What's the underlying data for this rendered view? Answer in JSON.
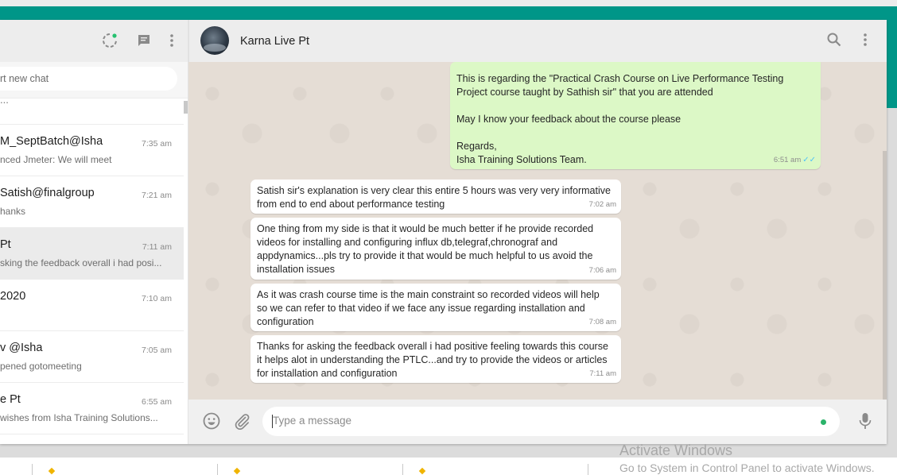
{
  "sidebar": {
    "search_placeholder": "rt new chat",
    "partial_top_text": "...",
    "chats": [
      {
        "name": "M_SeptBatch@Isha",
        "time": "7:35 am",
        "preview": "nced Jmeter: We will meet",
        "active": false
      },
      {
        "name": "Satish@finalgroup",
        "time": "7:21 am",
        "preview": "hanks",
        "active": false
      },
      {
        "name": "Pt",
        "time": "7:11 am",
        "preview": "sking the feedback overall i had posi...",
        "active": true
      },
      {
        "name": "2020",
        "time": "7:10 am",
        "preview": "",
        "active": false
      },
      {
        "name": "v @Isha",
        "time": "7:05 am",
        "preview": "pened gotomeeting",
        "active": false
      },
      {
        "name": "e Pt",
        "time": "6:55 am",
        "preview": "wishes from Isha Training Solutions...",
        "active": false
      }
    ]
  },
  "conversation": {
    "contact_name": "Karna Live Pt",
    "input_placeholder": "Type a message",
    "messages": [
      {
        "direction": "out",
        "lines": [
          "This is regarding the \"Practical Crash Course on Live Performance Testing",
          "Project  course taught by Sathish sir\" that you are attended",
          "",
          "May I know your feedback about the course please",
          "",
          "Regards,",
          "Isha Training Solutions Team."
        ],
        "time": "6:51 am",
        "ticks": "✓✓"
      },
      {
        "direction": "in",
        "lines": [
          "Satish sir's explanation is very clear this entire 5 hours was very very informative",
          "from end to end about performance testing"
        ],
        "time": "7:02 am"
      },
      {
        "direction": "in",
        "lines": [
          "One thing from my side is that it would be much better if he provide recorded",
          "videos for installing and configuring influx db,telegraf,chronograf and",
          "appdynamics...pls try to provide it that would be much helpful to us avoid the",
          "installation issues"
        ],
        "time": "7:06 am"
      },
      {
        "direction": "in",
        "lines": [
          "As it was crash course time is the main constraint so recorded videos will help",
          "so we can refer to that video if we face any issue regarding installation and",
          "configuration"
        ],
        "time": "7:08 am"
      },
      {
        "direction": "in",
        "lines": [
          "Thanks for asking the feedback overall i had positive feeling towards this course",
          "it helps alot in understanding the PTLC...and try to provide the videos or articles",
          "for installation and configuration"
        ],
        "time": "7:11 am"
      }
    ]
  },
  "os": {
    "activate_title": "Activate Windows",
    "activate_sub": "Go to System in Control Panel to activate Windows."
  },
  "colors": {
    "teal": "#009688",
    "outgoing_bubble": "#dcf8c6",
    "incoming_bubble": "#ffffff",
    "chat_background": "#e5ddd5",
    "read_ticks": "#4fc3f7"
  }
}
